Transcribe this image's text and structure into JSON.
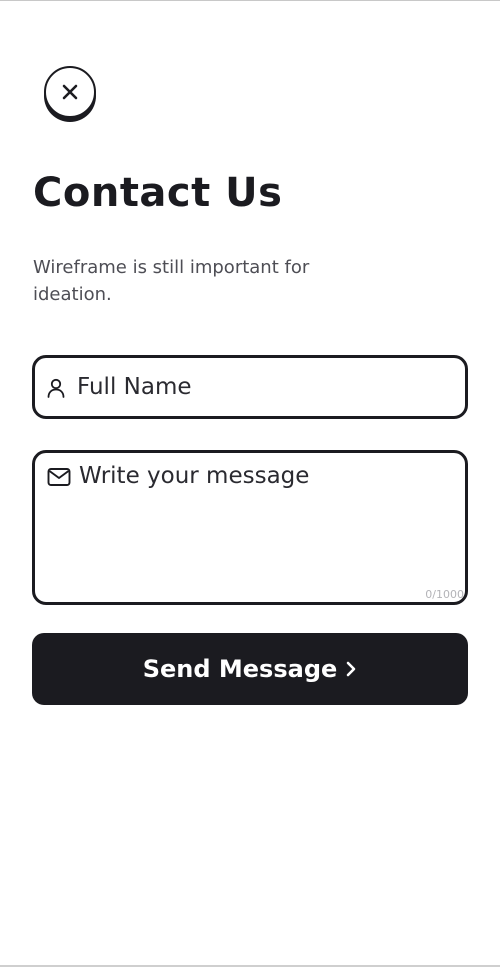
{
  "header": {
    "close_icon": "close-icon"
  },
  "page": {
    "title": "Contact Us",
    "subtitle": "Wireframe is still important for ideation."
  },
  "form": {
    "name_field": {
      "placeholder": "Full Name",
      "icon": "user-icon"
    },
    "message_field": {
      "placeholder": "Write your message",
      "icon": "mail-icon",
      "counter": "0/1000"
    },
    "submit": {
      "label": "Send Message",
      "icon": "chevron-right-icon"
    }
  },
  "colors": {
    "primary": "#1b1b20",
    "background": "#ffffff",
    "subtitle": "#4e4e55",
    "counter": "#b4b4b8"
  }
}
